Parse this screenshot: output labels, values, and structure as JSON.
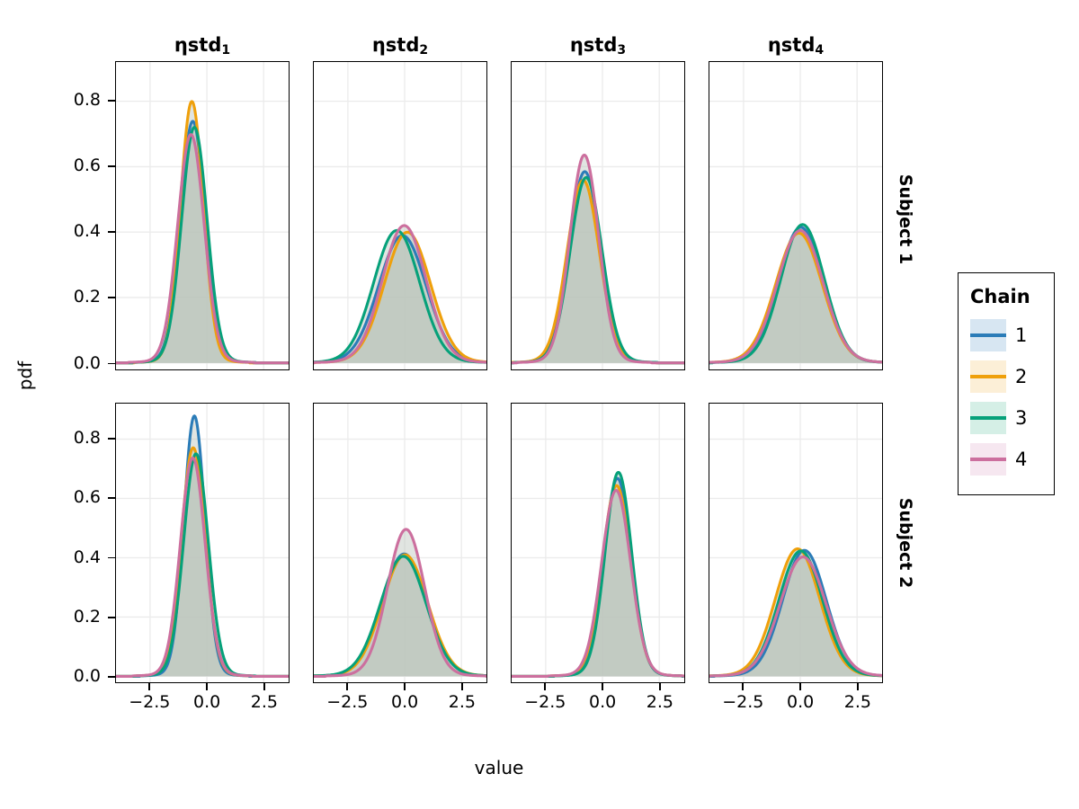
{
  "chart_data": {
    "type": "line",
    "plot_kind": "faceted-density-ridge",
    "title": "",
    "xlabel": "value",
    "ylabel": "pdf",
    "xlim": [
      -4.0,
      3.6
    ],
    "ylim": [
      -0.02,
      0.92
    ],
    "xticks": [
      -2.5,
      0.0,
      2.5
    ],
    "xtick_labels": [
      "−2.5",
      "0.0",
      "2.5"
    ],
    "yticks": [
      0.0,
      0.2,
      0.4,
      0.6,
      0.8
    ],
    "ytick_labels": [
      "0.0",
      "0.2",
      "0.4",
      "0.6",
      "0.8"
    ],
    "grid": true,
    "grid_color": "#ebebeb",
    "fill_color": "#bcc6bc",
    "fill_opacity": 0.45,
    "legend": {
      "title": "Chain",
      "position": "right",
      "entries": [
        {
          "label": "1",
          "color": "#2b7cb8",
          "key_fill": "#d7e6f2"
        },
        {
          "label": "2",
          "color": "#efa00b",
          "key_fill": "#fcefd7"
        },
        {
          "label": "3",
          "color": "#06a17a",
          "key_fill": "#d5efe6"
        },
        {
          "label": "4",
          "color": "#cc6f9e",
          "key_fill": "#f6e7f0"
        }
      ]
    },
    "facet_cols": [
      {
        "label": "ηstd",
        "sub": "1"
      },
      {
        "label": "ηstd",
        "sub": "2"
      },
      {
        "label": "ηstd",
        "sub": "3"
      },
      {
        "label": "ηstd",
        "sub": "4"
      }
    ],
    "facet_rows": [
      {
        "label": "Subject 1"
      },
      {
        "label": "Subject 2"
      }
    ],
    "panels": [
      {
        "row": 0,
        "col": 0,
        "row_label": "Subject 1",
        "col_label": "ηstd1",
        "series": [
          {
            "name": "1",
            "mu": -0.62,
            "sigma": 0.545,
            "peak": 0.73
          },
          {
            "name": "2",
            "mu": -0.66,
            "sigma": 0.505,
            "peak": 0.79
          },
          {
            "name": "3",
            "mu": -0.55,
            "sigma": 0.56,
            "peak": 0.712
          },
          {
            "name": "4",
            "mu": -0.7,
            "sigma": 0.58,
            "peak": 0.69
          }
        ]
      },
      {
        "row": 0,
        "col": 1,
        "row_label": "Subject 1",
        "col_label": "ηstd2",
        "series": [
          {
            "name": "1",
            "mu": -0.1,
            "sigma": 1.04,
            "peak": 0.385
          },
          {
            "name": "2",
            "mu": 0.12,
            "sigma": 1.01,
            "peak": 0.395
          },
          {
            "name": "3",
            "mu": -0.35,
            "sigma": 1.01,
            "peak": 0.4
          },
          {
            "name": "4",
            "mu": -0.02,
            "sigma": 0.96,
            "peak": 0.415
          }
        ]
      },
      {
        "row": 0,
        "col": 2,
        "row_label": "Subject 1",
        "col_label": "ηstd3",
        "series": [
          {
            "name": "1",
            "mu": -0.78,
            "sigma": 0.69,
            "peak": 0.578
          },
          {
            "name": "2",
            "mu": -0.85,
            "sigma": 0.71,
            "peak": 0.552
          },
          {
            "name": "3",
            "mu": -0.72,
            "sigma": 0.7,
            "peak": 0.56
          },
          {
            "name": "4",
            "mu": -0.8,
            "sigma": 0.635,
            "peak": 0.628
          }
        ]
      },
      {
        "row": 0,
        "col": 3,
        "row_label": "Subject 1",
        "col_label": "ηstd4",
        "series": [
          {
            "name": "1",
            "mu": 0.02,
            "sigma": 0.975,
            "peak": 0.41
          },
          {
            "name": "2",
            "mu": -0.06,
            "sigma": 1.02,
            "peak": 0.392
          },
          {
            "name": "3",
            "mu": 0.1,
            "sigma": 0.955,
            "peak": 0.418
          },
          {
            "name": "4",
            "mu": 0.0,
            "sigma": 1.0,
            "peak": 0.4
          }
        ]
      },
      {
        "row": 1,
        "col": 0,
        "row_label": "Subject 2",
        "col_label": "ηstd1",
        "series": [
          {
            "name": "1",
            "mu": -0.55,
            "sigma": 0.465,
            "peak": 0.868
          },
          {
            "name": "2",
            "mu": -0.6,
            "sigma": 0.525,
            "peak": 0.762
          },
          {
            "name": "3",
            "mu": -0.48,
            "sigma": 0.54,
            "peak": 0.742
          },
          {
            "name": "4",
            "mu": -0.62,
            "sigma": 0.545,
            "peak": 0.728
          }
        ]
      },
      {
        "row": 1,
        "col": 1,
        "row_label": "Subject 2",
        "col_label": "ηstd2",
        "series": [
          {
            "name": "1",
            "mu": -0.02,
            "sigma": 0.985,
            "peak": 0.408
          },
          {
            "name": "2",
            "mu": 0.02,
            "sigma": 0.99,
            "peak": 0.405
          },
          {
            "name": "3",
            "mu": -0.06,
            "sigma": 1.0,
            "peak": 0.4
          },
          {
            "name": "4",
            "mu": 0.06,
            "sigma": 0.815,
            "peak": 0.49
          }
        ]
      },
      {
        "row": 1,
        "col": 2,
        "row_label": "Subject 2",
        "col_label": "ηstd3",
        "series": [
          {
            "name": "1",
            "mu": 0.66,
            "sigma": 0.6,
            "peak": 0.66
          },
          {
            "name": "2",
            "mu": 0.62,
            "sigma": 0.625,
            "peak": 0.636
          },
          {
            "name": "3",
            "mu": 0.7,
            "sigma": 0.585,
            "peak": 0.68
          },
          {
            "name": "4",
            "mu": 0.6,
            "sigma": 0.64,
            "peak": 0.62
          }
        ]
      },
      {
        "row": 1,
        "col": 3,
        "row_label": "Subject 2",
        "col_label": "ηstd4",
        "series": [
          {
            "name": "1",
            "mu": 0.18,
            "sigma": 0.955,
            "peak": 0.42
          },
          {
            "name": "2",
            "mu": -0.12,
            "sigma": 0.975,
            "peak": 0.425
          },
          {
            "name": "3",
            "mu": 0.02,
            "sigma": 0.96,
            "peak": 0.418
          },
          {
            "name": "4",
            "mu": 0.12,
            "sigma": 1.005,
            "peak": 0.398
          }
        ]
      }
    ]
  }
}
